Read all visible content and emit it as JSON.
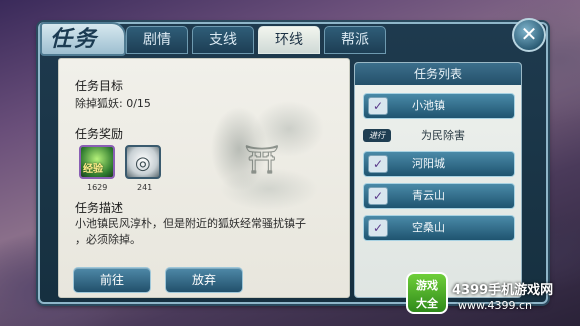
{
  "window": {
    "title": "任务"
  },
  "tabs": [
    {
      "label": "剧情",
      "active": false
    },
    {
      "label": "支线",
      "active": false
    },
    {
      "label": "环线",
      "active": true
    },
    {
      "label": "帮派",
      "active": false
    }
  ],
  "close_icon": "close-icon",
  "task": {
    "goal_heading": "任务目标",
    "goal_text": "除掉狐妖: 0/15",
    "reward_heading": "任务奖励",
    "rewards": [
      {
        "label": "经验",
        "icon": "exp-orb-icon",
        "count": "1629"
      },
      {
        "label": "",
        "icon": "silver-coin-icon",
        "count": "241"
      }
    ],
    "desc_heading": "任务描述",
    "desc_line1": "小池镇民风淳朴，但是附近的狐妖经常骚扰镇子",
    "desc_line2": "，必须除掉。"
  },
  "buttons": {
    "go": "前往",
    "abandon": "放弃"
  },
  "quest_list": {
    "header": "任务列表",
    "items": [
      {
        "label": "小池镇",
        "icon": "check-icon"
      },
      {
        "badge": "进行",
        "label": "为民除害"
      },
      {
        "label": "河阳城",
        "icon": "check-icon"
      },
      {
        "label": "青云山",
        "icon": "check-icon"
      },
      {
        "label": "空桑山",
        "icon": "check-icon"
      }
    ]
  },
  "watermark": {
    "logo_line1": "游戏",
    "logo_line2": "大全",
    "title": "4399手机游戏网",
    "url": "www.4399.cn"
  },
  "colors": {
    "frame": "#1e3a4e",
    "accent": "#4a8aa8",
    "parchment": "#f1f0ea",
    "exp_label": "#ffec8a"
  }
}
